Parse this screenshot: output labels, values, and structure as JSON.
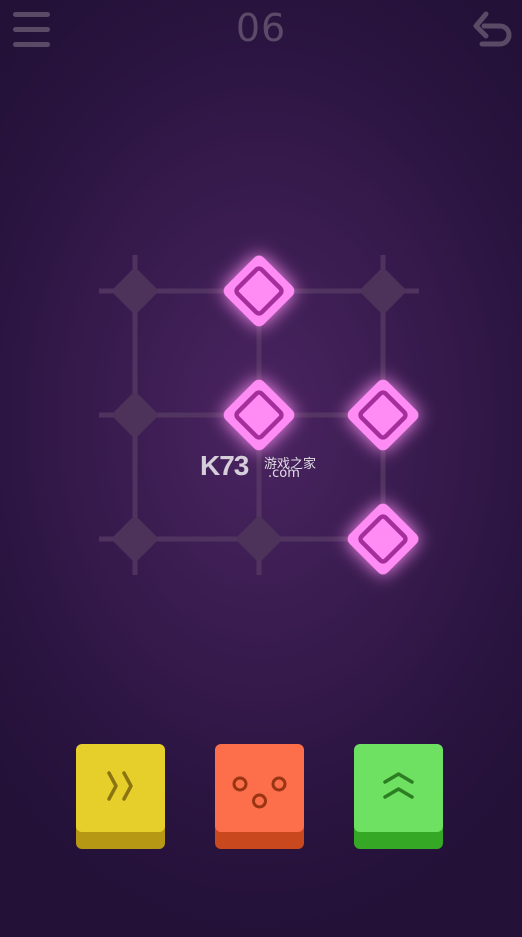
{
  "header": {
    "level": "06",
    "menu_icon": "hamburger-menu-icon",
    "undo_icon": "undo-arrow-icon"
  },
  "board": {
    "grid_rows": 3,
    "grid_cols": 3,
    "active_cells": [
      [
        0,
        1
      ],
      [
        1,
        1
      ],
      [
        1,
        2
      ],
      [
        2,
        2
      ]
    ],
    "colors": {
      "active_tile": "#ff8cf4",
      "active_ring": "#a32e9c",
      "inactive_node": "#4d3359",
      "grid_line": "#5a3d66"
    }
  },
  "watermark": {
    "logo": "K73",
    "site_cn": "游戏之家",
    "domain": ".com"
  },
  "buttons": [
    {
      "name": "yellow",
      "icon": "double-chevron-right-icon",
      "face": "#e7cf2b",
      "base": "#b79814"
    },
    {
      "name": "orange",
      "icon": "three-dots-icon",
      "face": "#fd6e4b",
      "base": "#c9481d"
    },
    {
      "name": "green",
      "icon": "double-chevron-up-icon",
      "face": "#6ee062",
      "base": "#35a825"
    }
  ]
}
